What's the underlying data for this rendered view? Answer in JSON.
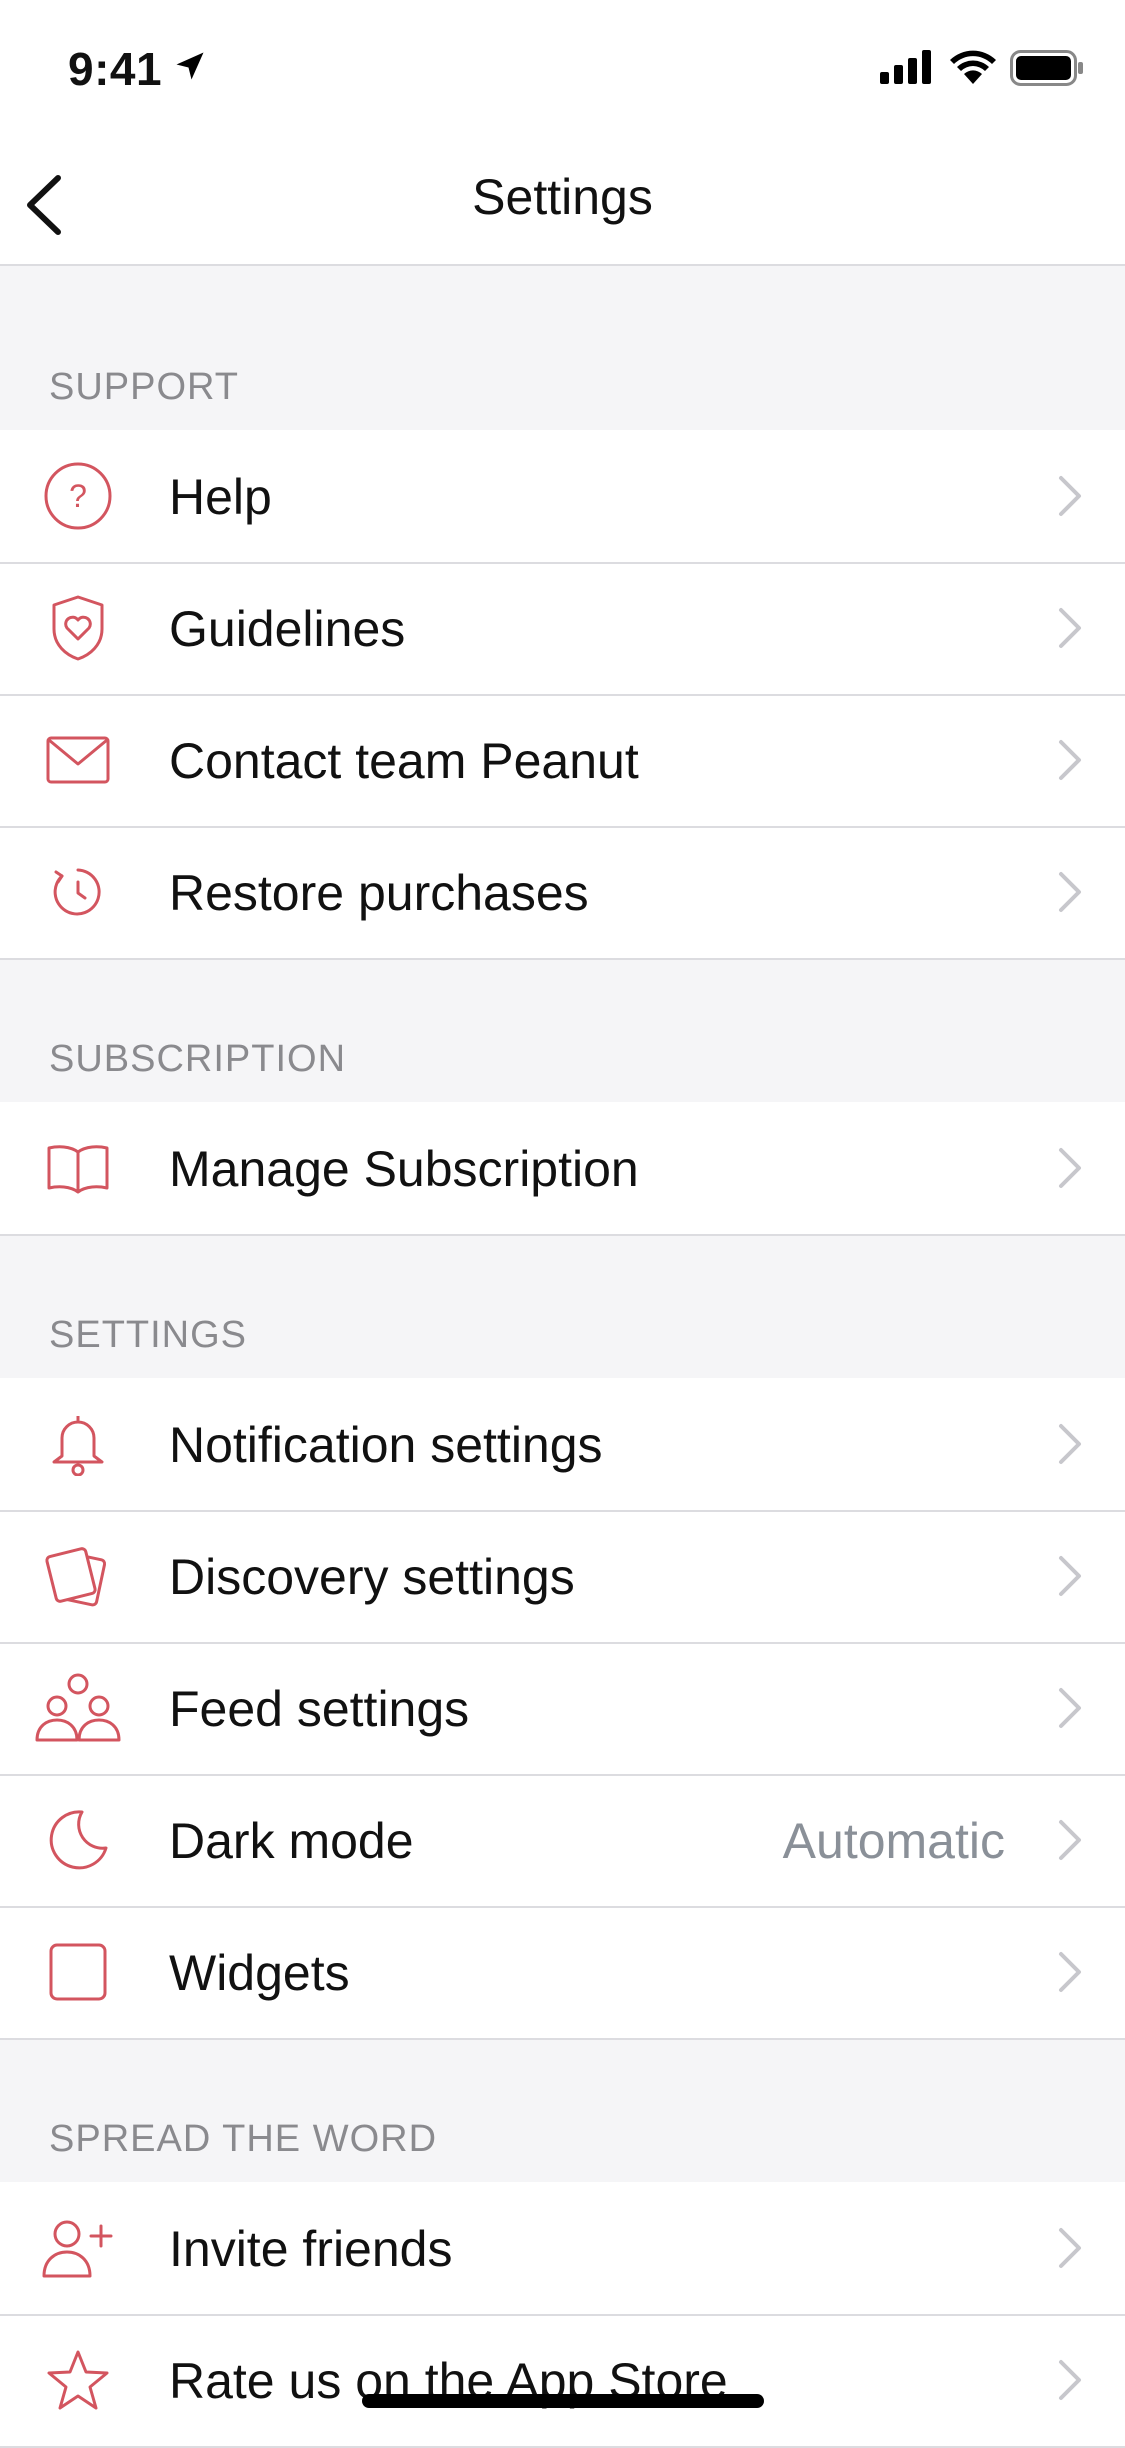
{
  "status_bar": {
    "time": "9:41"
  },
  "nav": {
    "title": "Settings"
  },
  "colors": {
    "accent": "#d3555f",
    "chevron": "#c7c7cc",
    "secondary_text": "#8a9098"
  },
  "sections": {
    "support": {
      "header": "SUPPORT",
      "items": [
        {
          "label": "Help",
          "icon": "help-icon"
        },
        {
          "label": "Guidelines",
          "icon": "shield-heart-icon"
        },
        {
          "label": "Contact team Peanut",
          "icon": "mail-icon"
        },
        {
          "label": "Restore purchases",
          "icon": "restore-icon"
        }
      ]
    },
    "subscription": {
      "header": "SUBSCRIPTION",
      "items": [
        {
          "label": "Manage Subscription",
          "icon": "book-icon"
        }
      ]
    },
    "settings": {
      "header": "SETTINGS",
      "items": [
        {
          "label": "Notification settings",
          "icon": "bell-icon"
        },
        {
          "label": "Discovery settings",
          "icon": "cards-icon"
        },
        {
          "label": "Feed settings",
          "icon": "people-icon"
        },
        {
          "label": "Dark mode",
          "icon": "moon-icon",
          "value": "Automatic"
        },
        {
          "label": "Widgets",
          "icon": "square-icon"
        }
      ]
    },
    "spread": {
      "header": "SPREAD THE WORD",
      "items": [
        {
          "label": "Invite friends",
          "icon": "add-user-icon"
        },
        {
          "label": "Rate us on the App Store",
          "icon": "star-icon"
        }
      ]
    }
  }
}
